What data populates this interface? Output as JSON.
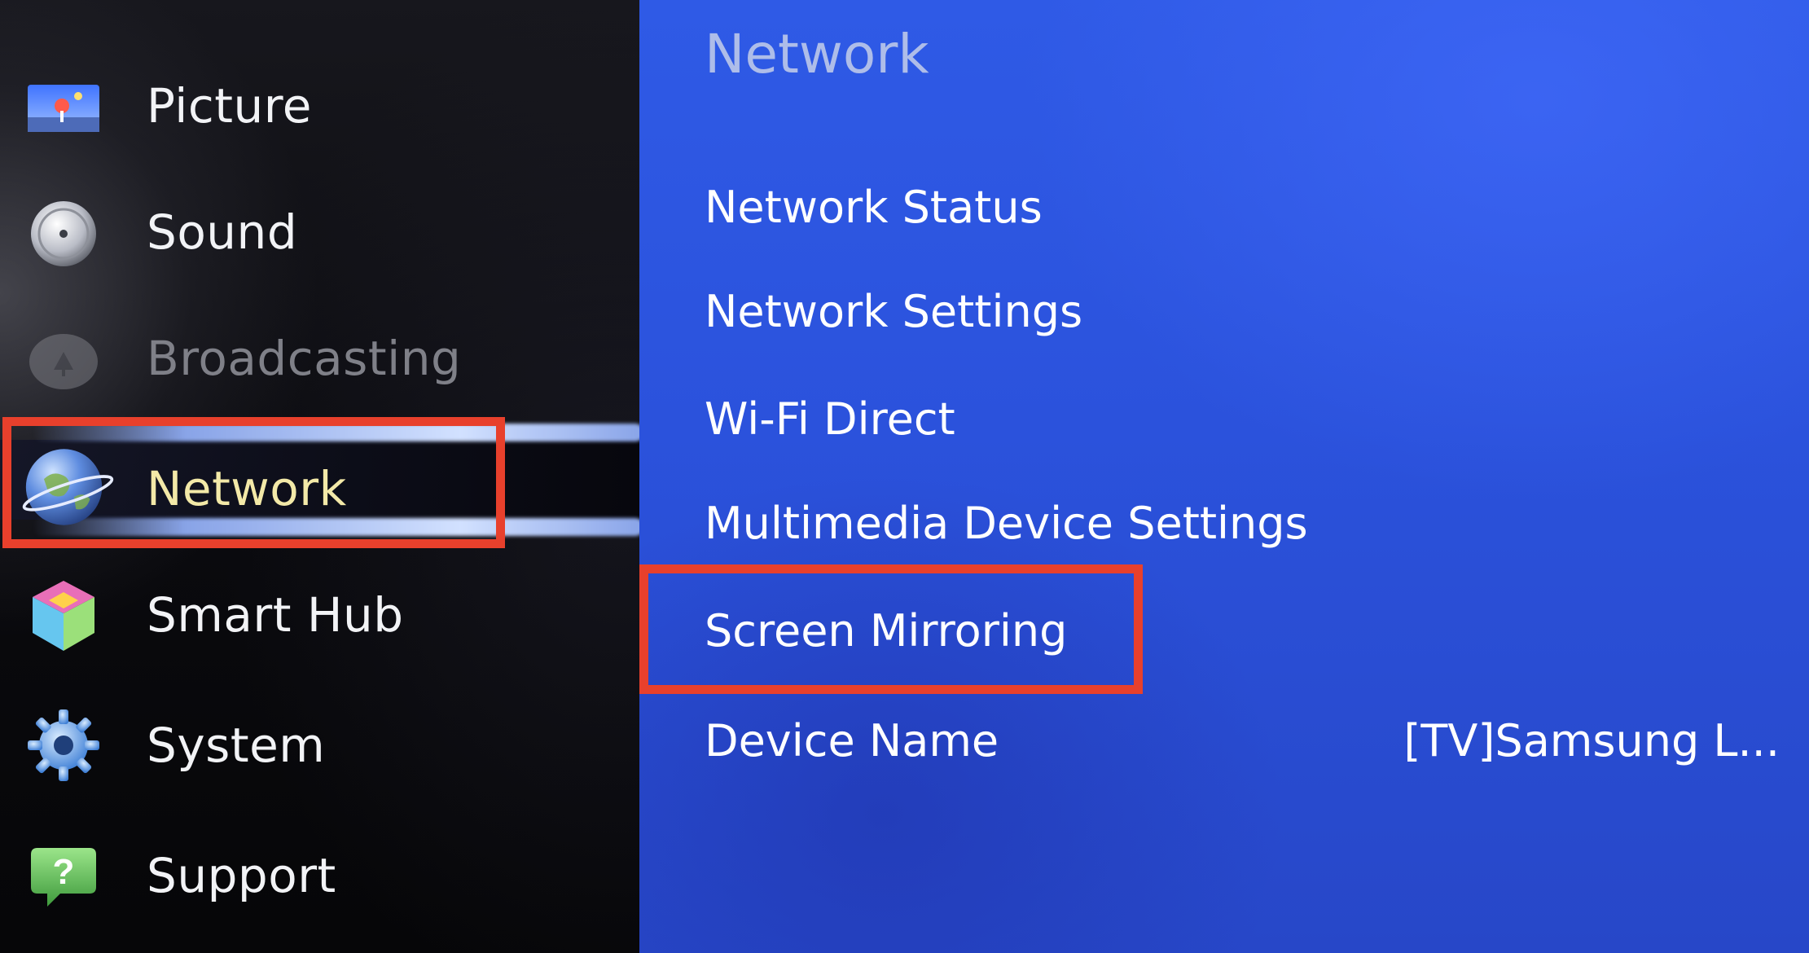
{
  "sidebar": {
    "items": [
      {
        "label": "Picture",
        "icon": "picture-icon",
        "state": "normal"
      },
      {
        "label": "Sound",
        "icon": "sound-icon",
        "state": "normal"
      },
      {
        "label": "Broadcasting",
        "icon": "broadcasting-icon",
        "state": "disabled"
      },
      {
        "label": "Network",
        "icon": "globe-icon",
        "state": "selected"
      },
      {
        "label": "Smart Hub",
        "icon": "smart-hub-cube-icon",
        "state": "normal"
      },
      {
        "label": "System",
        "icon": "gear-icon",
        "state": "normal"
      },
      {
        "label": "Support",
        "icon": "help-bubble-icon",
        "state": "normal"
      }
    ]
  },
  "panel": {
    "title": "Network",
    "items": [
      {
        "label": "Network Status",
        "value": ""
      },
      {
        "label": "Network Settings",
        "value": ""
      },
      {
        "label": "Wi-Fi Direct",
        "value": ""
      },
      {
        "label": "Multimedia Device Settings",
        "value": ""
      },
      {
        "label": "Screen Mirroring",
        "value": ""
      },
      {
        "label": "Device Name",
        "value": "[TV]Samsung L..."
      }
    ]
  },
  "colors": {
    "panel_blue": "#2d55e0",
    "highlight_red": "#e8402c",
    "selected_text": "#f3e9a8"
  },
  "annotations": {
    "highlighted_items": [
      "Network",
      "Screen Mirroring"
    ]
  }
}
